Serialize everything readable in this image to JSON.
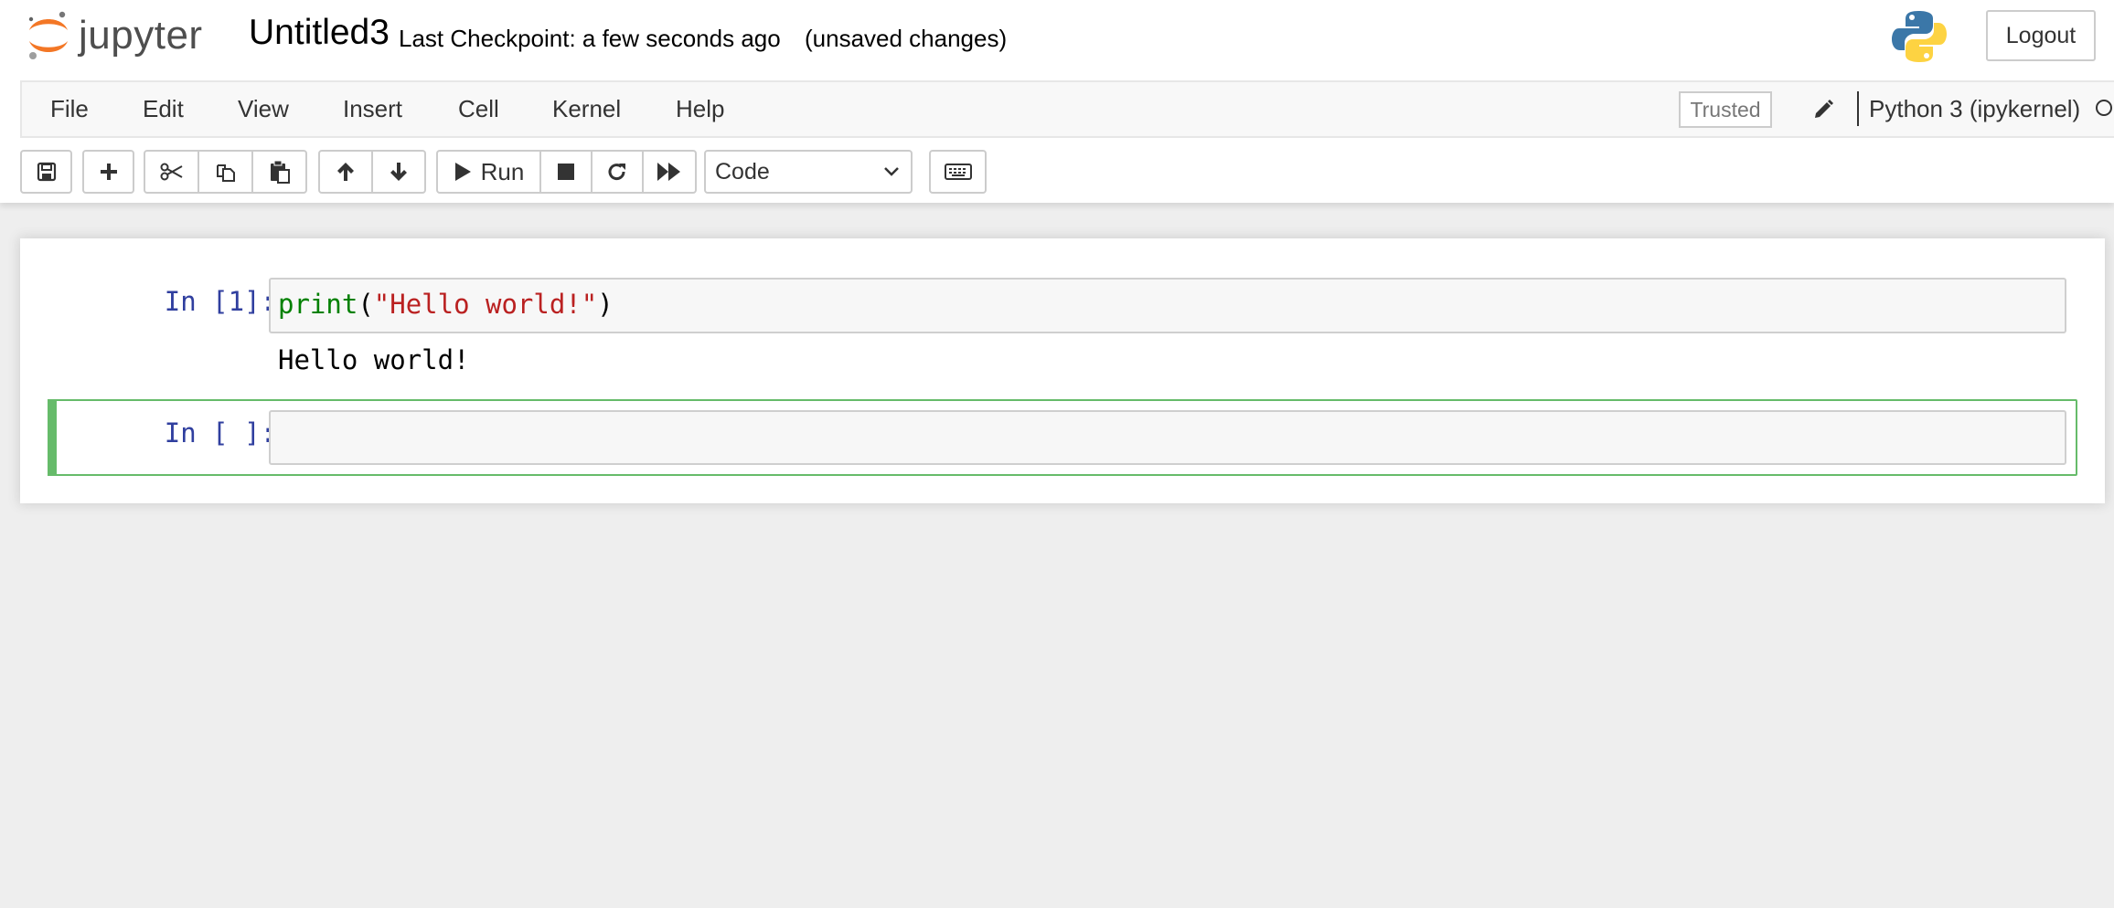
{
  "header": {
    "logo_text": "jupyter",
    "notebook_title": "Untitled3",
    "checkpoint": "Last Checkpoint: a few seconds ago",
    "save_status": "(unsaved changes)",
    "logout_label": "Logout",
    "kernel_logo_icon": "python-logo-icon"
  },
  "menubar": {
    "items": [
      "File",
      "Edit",
      "View",
      "Insert",
      "Cell",
      "Kernel",
      "Help"
    ],
    "trusted_label": "Trusted",
    "kernel_name": "Python 3 (ipykernel)",
    "kernel_status": "idle"
  },
  "toolbar": {
    "run_label": "Run",
    "cell_type": "Code",
    "icons": [
      "save-icon",
      "plus-icon",
      "cut-icon",
      "copy-icon",
      "paste-icon",
      "arrow-up-icon",
      "arrow-down-icon",
      "play-icon",
      "stop-icon",
      "restart-icon",
      "fast-forward-icon",
      "keyboard-icon"
    ]
  },
  "cells": [
    {
      "prompt": "In [1]:",
      "code": {
        "builtin": "print",
        "open": "(",
        "string": "\"Hello world!\"",
        "close": ")"
      },
      "output": "Hello world!"
    },
    {
      "prompt": "In [ ]:",
      "code": "",
      "selected": true
    }
  ],
  "colors": {
    "prompt": "#303f9f",
    "builtin": "#008000",
    "string": "#ba2121",
    "selected_cell_border": "#66bb6a",
    "logo_orange": "#f37726"
  }
}
